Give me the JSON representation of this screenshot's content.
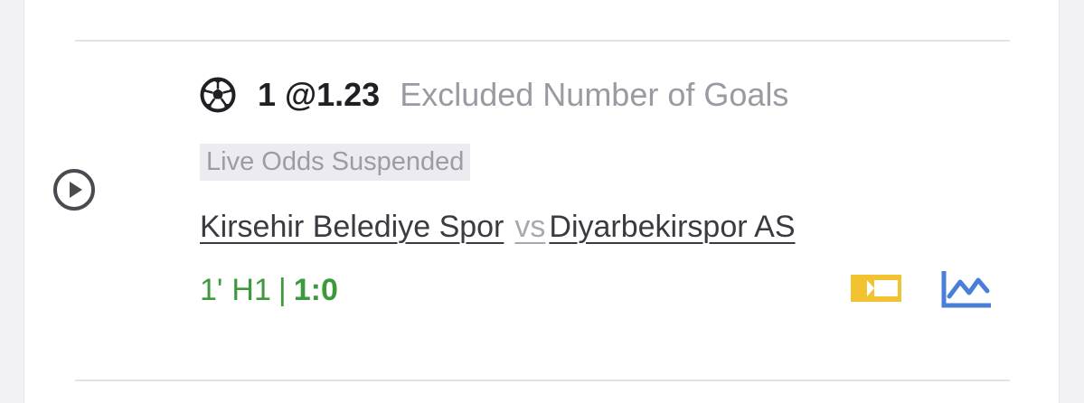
{
  "bet": {
    "selection": "1 @1.23",
    "market": "Excluded Number of Goals"
  },
  "status": {
    "label": "Live Odds Suspended"
  },
  "match": {
    "home_team": "Kirsehir Belediye Spor",
    "vs": "vs",
    "away_team": "Diyarbekirspor AS"
  },
  "live": {
    "minute": "1'",
    "period": "H1",
    "separator": "|",
    "score": "1:0"
  },
  "icons": {
    "play": "play-circle-icon",
    "sport": "soccer-ball-icon",
    "ticket": "ticket-icon",
    "stats": "line-chart-icon"
  },
  "colors": {
    "live_green": "#3c9a3c",
    "ticket_yellow": "#f2c230",
    "stats_blue": "#4a7fd8"
  }
}
